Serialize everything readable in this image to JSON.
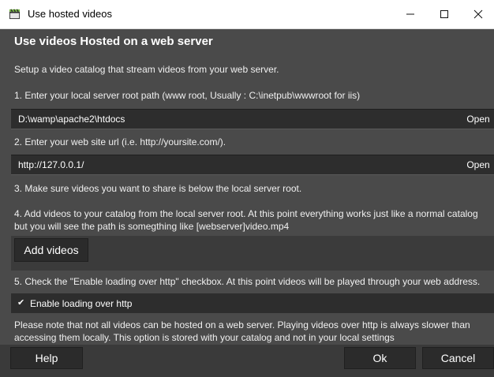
{
  "window": {
    "title": "Use hosted videos",
    "minimize_icon": "minimize-icon",
    "maximize_icon": "maximize-icon",
    "close_icon": "close-icon"
  },
  "content": {
    "heading": "Use videos Hosted on a web server",
    "intro": "Setup a video catalog that stream videos from your web server.",
    "step1": "1. Enter your local server root path (www root, Usually : C:\\inetpub\\wwwroot for iis)",
    "root_path": {
      "value": "D:\\wamp\\apache2\\htdocs",
      "open_label": "Open"
    },
    "step2": "2. Enter your web site url (i.e. http://yoursite.com/).",
    "site_url": {
      "value": "http://127.0.0.1/",
      "open_label": "Open"
    },
    "step3": "3. Make sure videos you want to share is below the local server root.",
    "step4": "4. Add videos to your catalog from the local server root. At this point everything works just like a normal catalog but you will see the path is somegthing like [webserver]video.mp4",
    "add_videos_label": "Add videos",
    "step5": "5. Check the \"Enable loading over http\" checkbox. At this point videos will be played through your web address.",
    "enable_http": {
      "label": "Enable loading over http",
      "checked": true
    },
    "note": "Please note that not all videos can be hosted on a web server. Playing videos over http is always slower than accessing them locally. This option is stored with your catalog and not in your local settings"
  },
  "footer": {
    "help_label": "Help",
    "ok_label": "Ok",
    "cancel_label": "Cancel"
  }
}
